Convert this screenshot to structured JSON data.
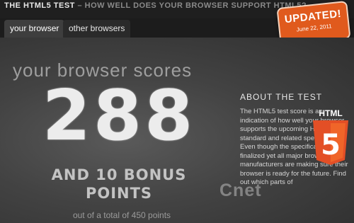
{
  "header": {
    "title": "THE HTML5 TEST",
    "tagline": " – HOW WELL DOES YOUR BROWSER SUPPORT HTML5?"
  },
  "tabs": [
    {
      "label": "your browser",
      "active": true
    },
    {
      "label": "other browsers",
      "active": false
    }
  ],
  "badge": {
    "title": "UPDATED!",
    "date": "June 22, 2011"
  },
  "score": {
    "headline": "your browser scores",
    "value": "288",
    "bonus": "AND 10 BONUS POINTS",
    "total": "out of a total of 450 points"
  },
  "about": {
    "heading": "ABOUT THE TEST",
    "text": "The HTML5 test score is an indication of how well your browser supports the upcoming HTML5 standard and related specifications. Even though the specification isn't finalized yet all major browser manufacturers are making sure their browser is ready for the future. Find out which parts of"
  },
  "logo": {
    "text": "HTML",
    "number": "5",
    "icon": "html5-logo-icon"
  },
  "watermark": {
    "text": "Cnet"
  },
  "colors": {
    "accent": "#e05a1d",
    "background": "#3a3a3a"
  }
}
